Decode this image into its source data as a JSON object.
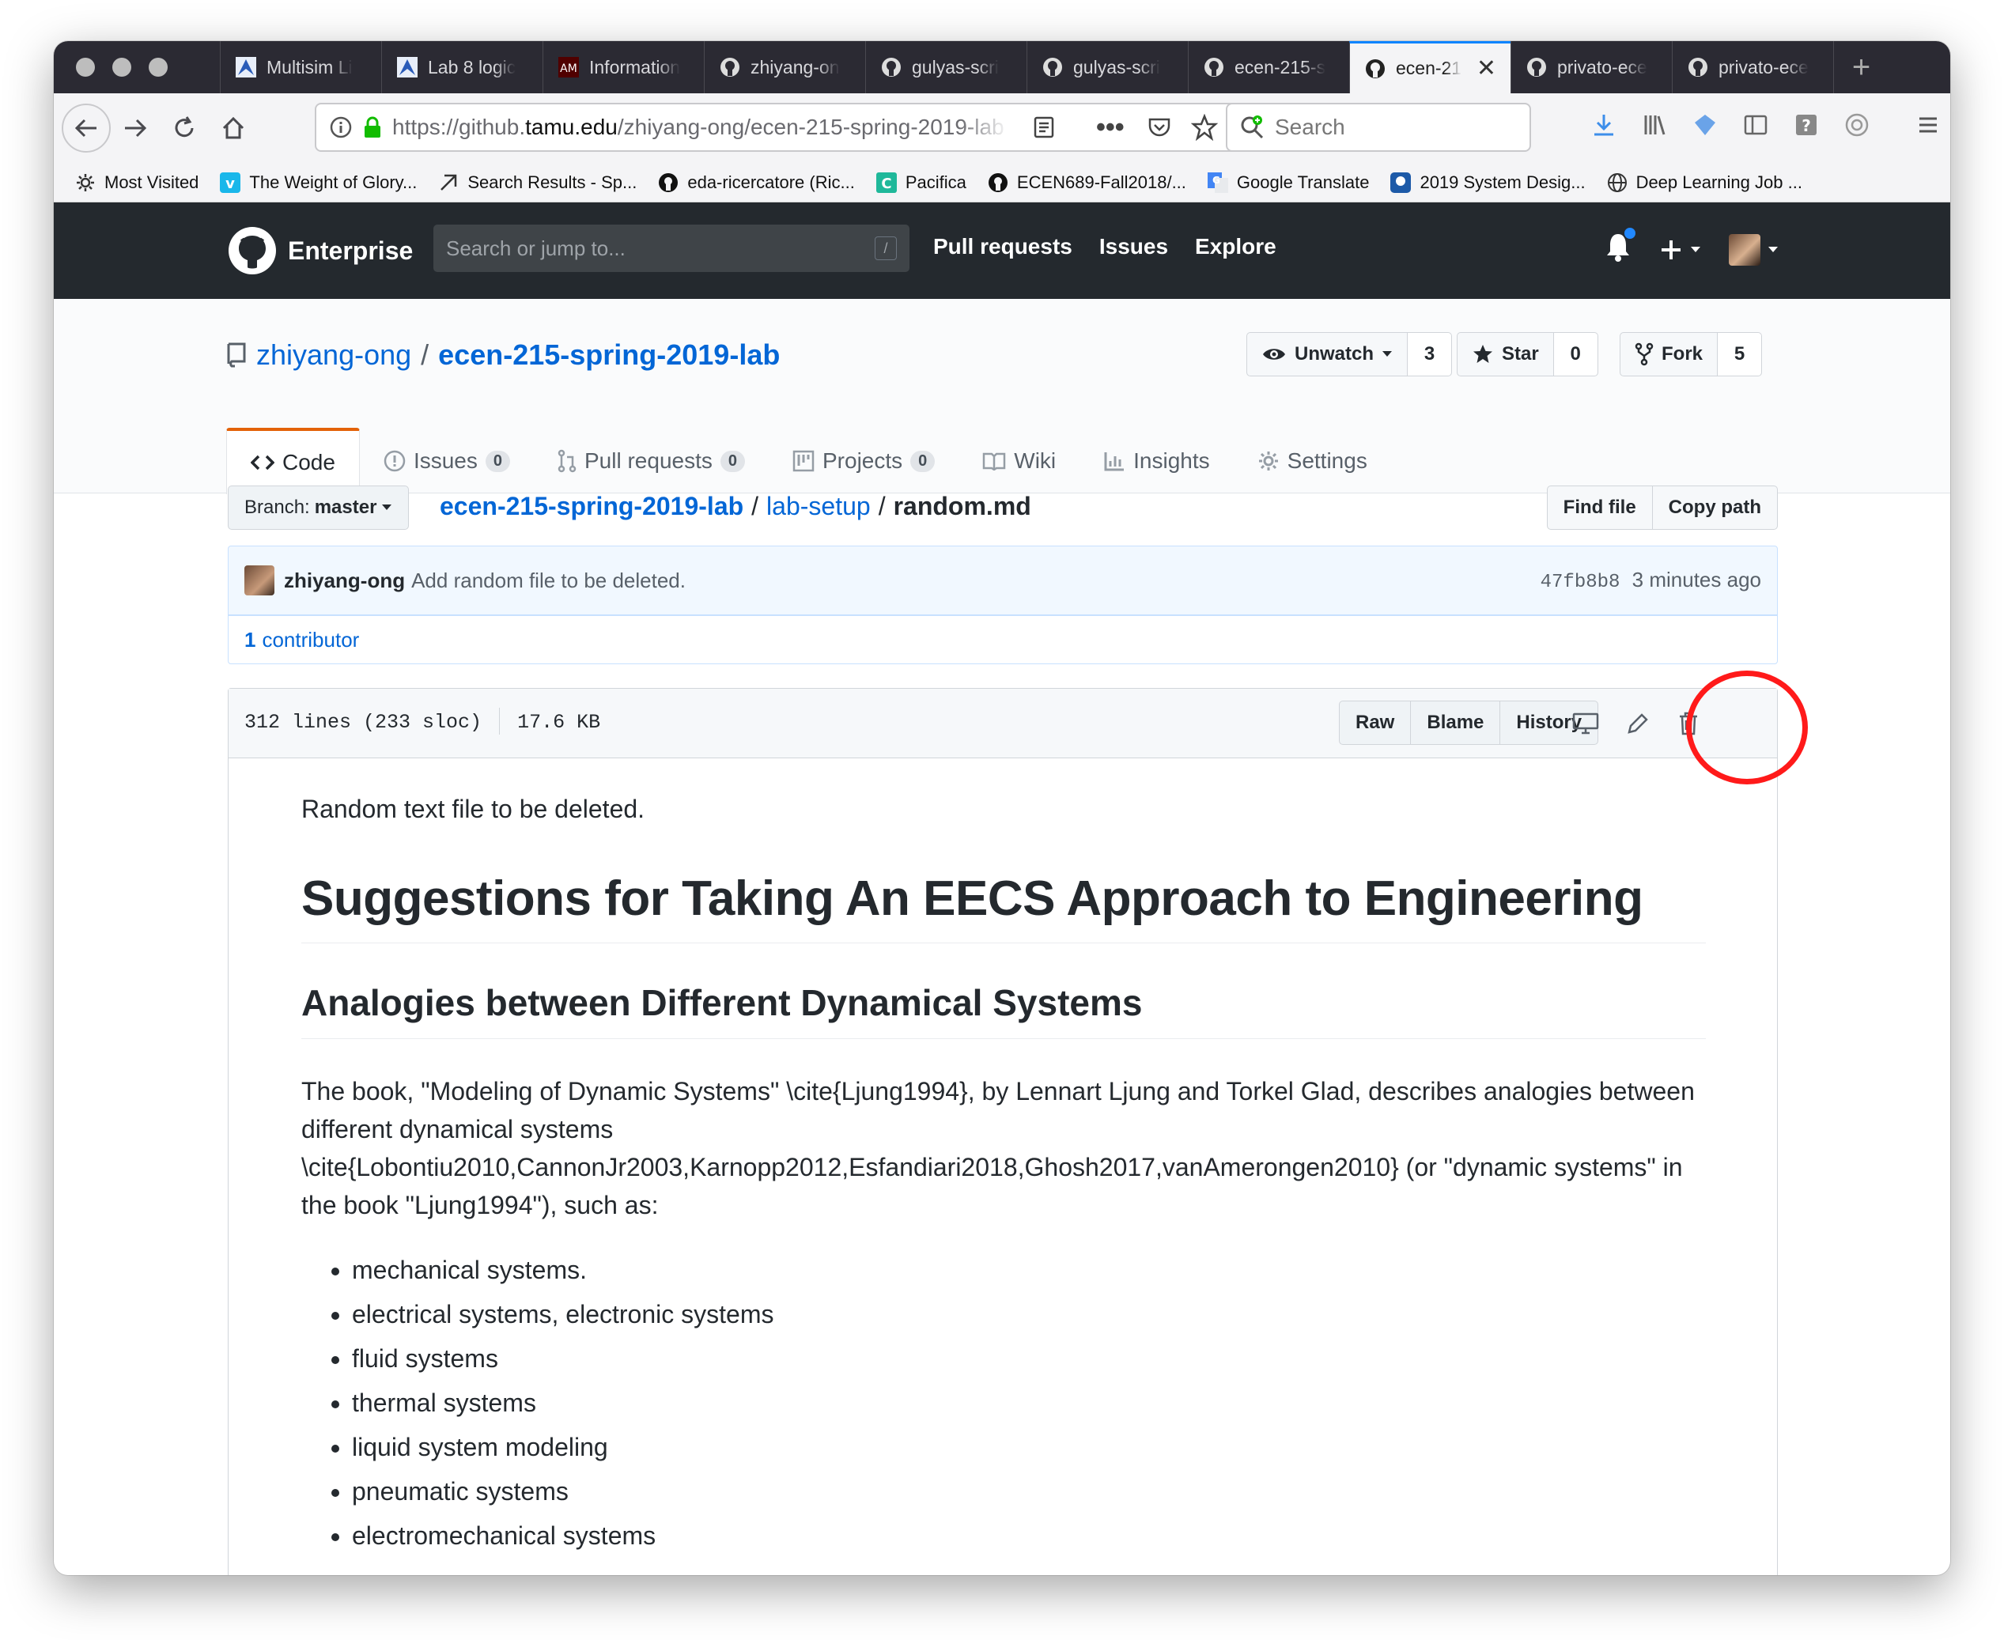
{
  "browser": {
    "tabs": [
      {
        "label": "Multisim Li",
        "icon": "multisim-icon"
      },
      {
        "label": "Lab 8 logic",
        "icon": "multisim-icon"
      },
      {
        "label": "Information",
        "icon": "tamu-icon"
      },
      {
        "label": "zhiyang-on",
        "icon": "github-icon"
      },
      {
        "label": "gulyas-scri",
        "icon": "github-icon"
      },
      {
        "label": "gulyas-scri",
        "icon": "github-icon"
      },
      {
        "label": "ecen-215-s",
        "icon": "github-icon"
      },
      {
        "label": "ecen-21",
        "icon": "github-icon",
        "active": true
      },
      {
        "label": "privato-ece",
        "icon": "github-icon"
      },
      {
        "label": "privato-ece",
        "icon": "github-icon"
      }
    ],
    "url_prefix": "https://github.",
    "url_domain": "tamu.edu",
    "url_suffix": "/zhiyang-ong/ecen-215-spring-2019-lab",
    "search_placeholder": "Search",
    "bookmarks": [
      {
        "label": "Most Visited"
      },
      {
        "label": "The Weight of Glory..."
      },
      {
        "label": "Search Results - Sp..."
      },
      {
        "label": "eda-ricercatore (Ric..."
      },
      {
        "label": "Pacifica"
      },
      {
        "label": "ECEN689-Fall2018/..."
      },
      {
        "label": "Google Translate"
      },
      {
        "label": "2019 System Desig..."
      },
      {
        "label": "Deep Learning Job ..."
      }
    ]
  },
  "gh": {
    "brand": "Enterprise",
    "search_placeholder": "Search or jump to...",
    "search_key": "/",
    "nav": [
      "Pull requests",
      "Issues",
      "Explore"
    ]
  },
  "repo": {
    "owner": "zhiyang-ong",
    "separator": "/",
    "name": "ecen-215-spring-2019-lab",
    "watch_label": "Unwatch",
    "watch_count": "3",
    "star_label": "Star",
    "star_count": "0",
    "fork_label": "Fork",
    "fork_count": "5",
    "tabs": {
      "code": "Code",
      "issues": "Issues",
      "issues_count": "0",
      "pulls": "Pull requests",
      "pulls_count": "0",
      "projects": "Projects",
      "projects_count": "0",
      "wiki": "Wiki",
      "insights": "Insights",
      "settings": "Settings"
    }
  },
  "file": {
    "branch_prefix": "Branch:",
    "branch": "master",
    "crumb_repo": "ecen-215-spring-2019-lab",
    "crumb_sep": "/",
    "crumb_dir": "lab-setup",
    "crumb_file": "random.md",
    "find_file": "Find file",
    "copy_path": "Copy path",
    "commit_author": "zhiyang-ong",
    "commit_message": "Add random file to be deleted.",
    "commit_sha": "47fb8b8",
    "commit_time": "3 minutes ago",
    "contributors_count": "1",
    "contributors_label": "contributor",
    "lines": "312 lines (233 sloc)",
    "size": "17.6 KB",
    "raw": "Raw",
    "blame": "Blame",
    "history": "History"
  },
  "content": {
    "intro": "Random text file to be deleted.",
    "h1": "Suggestions for Taking An EECS Approach to Engineering",
    "h2": "Analogies between Different Dynamical Systems",
    "paragraph": "The book, \"Modeling of Dynamic Systems\" \\cite{Ljung1994}, by Lennart Ljung and Torkel Glad, describes analogies between different dynamical systems \\cite{Lobontiu2010,CannonJr2003,Karnopp2012,Esfandiari2018,Ghosh2017,vanAmerongen2010} (or \"dynamic systems\" in the book \"Ljung1994\"), such as:",
    "list": [
      "mechanical systems.",
      "electrical systems, electronic systems",
      "fluid systems",
      "thermal systems",
      "liquid system modeling",
      "pneumatic systems",
      "electromechanical systems"
    ]
  },
  "colors": {
    "link": "#0366d6",
    "header_bg": "#24292e",
    "annotation_circle": "#ff1a1a"
  }
}
